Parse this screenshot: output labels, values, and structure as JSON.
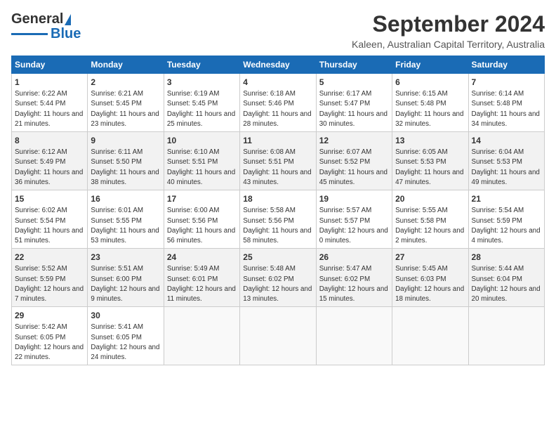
{
  "header": {
    "logo_general": "General",
    "logo_blue": "Blue",
    "month_title": "September 2024",
    "location": "Kaleen, Australian Capital Territory, Australia"
  },
  "weekdays": [
    "Sunday",
    "Monday",
    "Tuesday",
    "Wednesday",
    "Thursday",
    "Friday",
    "Saturday"
  ],
  "weeks": [
    [
      {
        "day": "1",
        "sunrise": "6:22 AM",
        "sunset": "5:44 PM",
        "daylight": "11 hours and 21 minutes."
      },
      {
        "day": "2",
        "sunrise": "6:21 AM",
        "sunset": "5:45 PM",
        "daylight": "11 hours and 23 minutes."
      },
      {
        "day": "3",
        "sunrise": "6:19 AM",
        "sunset": "5:45 PM",
        "daylight": "11 hours and 25 minutes."
      },
      {
        "day": "4",
        "sunrise": "6:18 AM",
        "sunset": "5:46 PM",
        "daylight": "11 hours and 28 minutes."
      },
      {
        "day": "5",
        "sunrise": "6:17 AM",
        "sunset": "5:47 PM",
        "daylight": "11 hours and 30 minutes."
      },
      {
        "day": "6",
        "sunrise": "6:15 AM",
        "sunset": "5:48 PM",
        "daylight": "11 hours and 32 minutes."
      },
      {
        "day": "7",
        "sunrise": "6:14 AM",
        "sunset": "5:48 PM",
        "daylight": "11 hours and 34 minutes."
      }
    ],
    [
      {
        "day": "8",
        "sunrise": "6:12 AM",
        "sunset": "5:49 PM",
        "daylight": "11 hours and 36 minutes."
      },
      {
        "day": "9",
        "sunrise": "6:11 AM",
        "sunset": "5:50 PM",
        "daylight": "11 hours and 38 minutes."
      },
      {
        "day": "10",
        "sunrise": "6:10 AM",
        "sunset": "5:51 PM",
        "daylight": "11 hours and 40 minutes."
      },
      {
        "day": "11",
        "sunrise": "6:08 AM",
        "sunset": "5:51 PM",
        "daylight": "11 hours and 43 minutes."
      },
      {
        "day": "12",
        "sunrise": "6:07 AM",
        "sunset": "5:52 PM",
        "daylight": "11 hours and 45 minutes."
      },
      {
        "day": "13",
        "sunrise": "6:05 AM",
        "sunset": "5:53 PM",
        "daylight": "11 hours and 47 minutes."
      },
      {
        "day": "14",
        "sunrise": "6:04 AM",
        "sunset": "5:53 PM",
        "daylight": "11 hours and 49 minutes."
      }
    ],
    [
      {
        "day": "15",
        "sunrise": "6:02 AM",
        "sunset": "5:54 PM",
        "daylight": "11 hours and 51 minutes."
      },
      {
        "day": "16",
        "sunrise": "6:01 AM",
        "sunset": "5:55 PM",
        "daylight": "11 hours and 53 minutes."
      },
      {
        "day": "17",
        "sunrise": "6:00 AM",
        "sunset": "5:56 PM",
        "daylight": "11 hours and 56 minutes."
      },
      {
        "day": "18",
        "sunrise": "5:58 AM",
        "sunset": "5:56 PM",
        "daylight": "11 hours and 58 minutes."
      },
      {
        "day": "19",
        "sunrise": "5:57 AM",
        "sunset": "5:57 PM",
        "daylight": "12 hours and 0 minutes."
      },
      {
        "day": "20",
        "sunrise": "5:55 AM",
        "sunset": "5:58 PM",
        "daylight": "12 hours and 2 minutes."
      },
      {
        "day": "21",
        "sunrise": "5:54 AM",
        "sunset": "5:59 PM",
        "daylight": "12 hours and 4 minutes."
      }
    ],
    [
      {
        "day": "22",
        "sunrise": "5:52 AM",
        "sunset": "5:59 PM",
        "daylight": "12 hours and 7 minutes."
      },
      {
        "day": "23",
        "sunrise": "5:51 AM",
        "sunset": "6:00 PM",
        "daylight": "12 hours and 9 minutes."
      },
      {
        "day": "24",
        "sunrise": "5:49 AM",
        "sunset": "6:01 PM",
        "daylight": "12 hours and 11 minutes."
      },
      {
        "day": "25",
        "sunrise": "5:48 AM",
        "sunset": "6:02 PM",
        "daylight": "12 hours and 13 minutes."
      },
      {
        "day": "26",
        "sunrise": "5:47 AM",
        "sunset": "6:02 PM",
        "daylight": "12 hours and 15 minutes."
      },
      {
        "day": "27",
        "sunrise": "5:45 AM",
        "sunset": "6:03 PM",
        "daylight": "12 hours and 18 minutes."
      },
      {
        "day": "28",
        "sunrise": "5:44 AM",
        "sunset": "6:04 PM",
        "daylight": "12 hours and 20 minutes."
      }
    ],
    [
      {
        "day": "29",
        "sunrise": "5:42 AM",
        "sunset": "6:05 PM",
        "daylight": "12 hours and 22 minutes."
      },
      {
        "day": "30",
        "sunrise": "5:41 AM",
        "sunset": "6:05 PM",
        "daylight": "12 hours and 24 minutes."
      },
      null,
      null,
      null,
      null,
      null
    ]
  ],
  "labels": {
    "sunrise": "Sunrise: ",
    "sunset": "Sunset: ",
    "daylight": "Daylight: "
  }
}
